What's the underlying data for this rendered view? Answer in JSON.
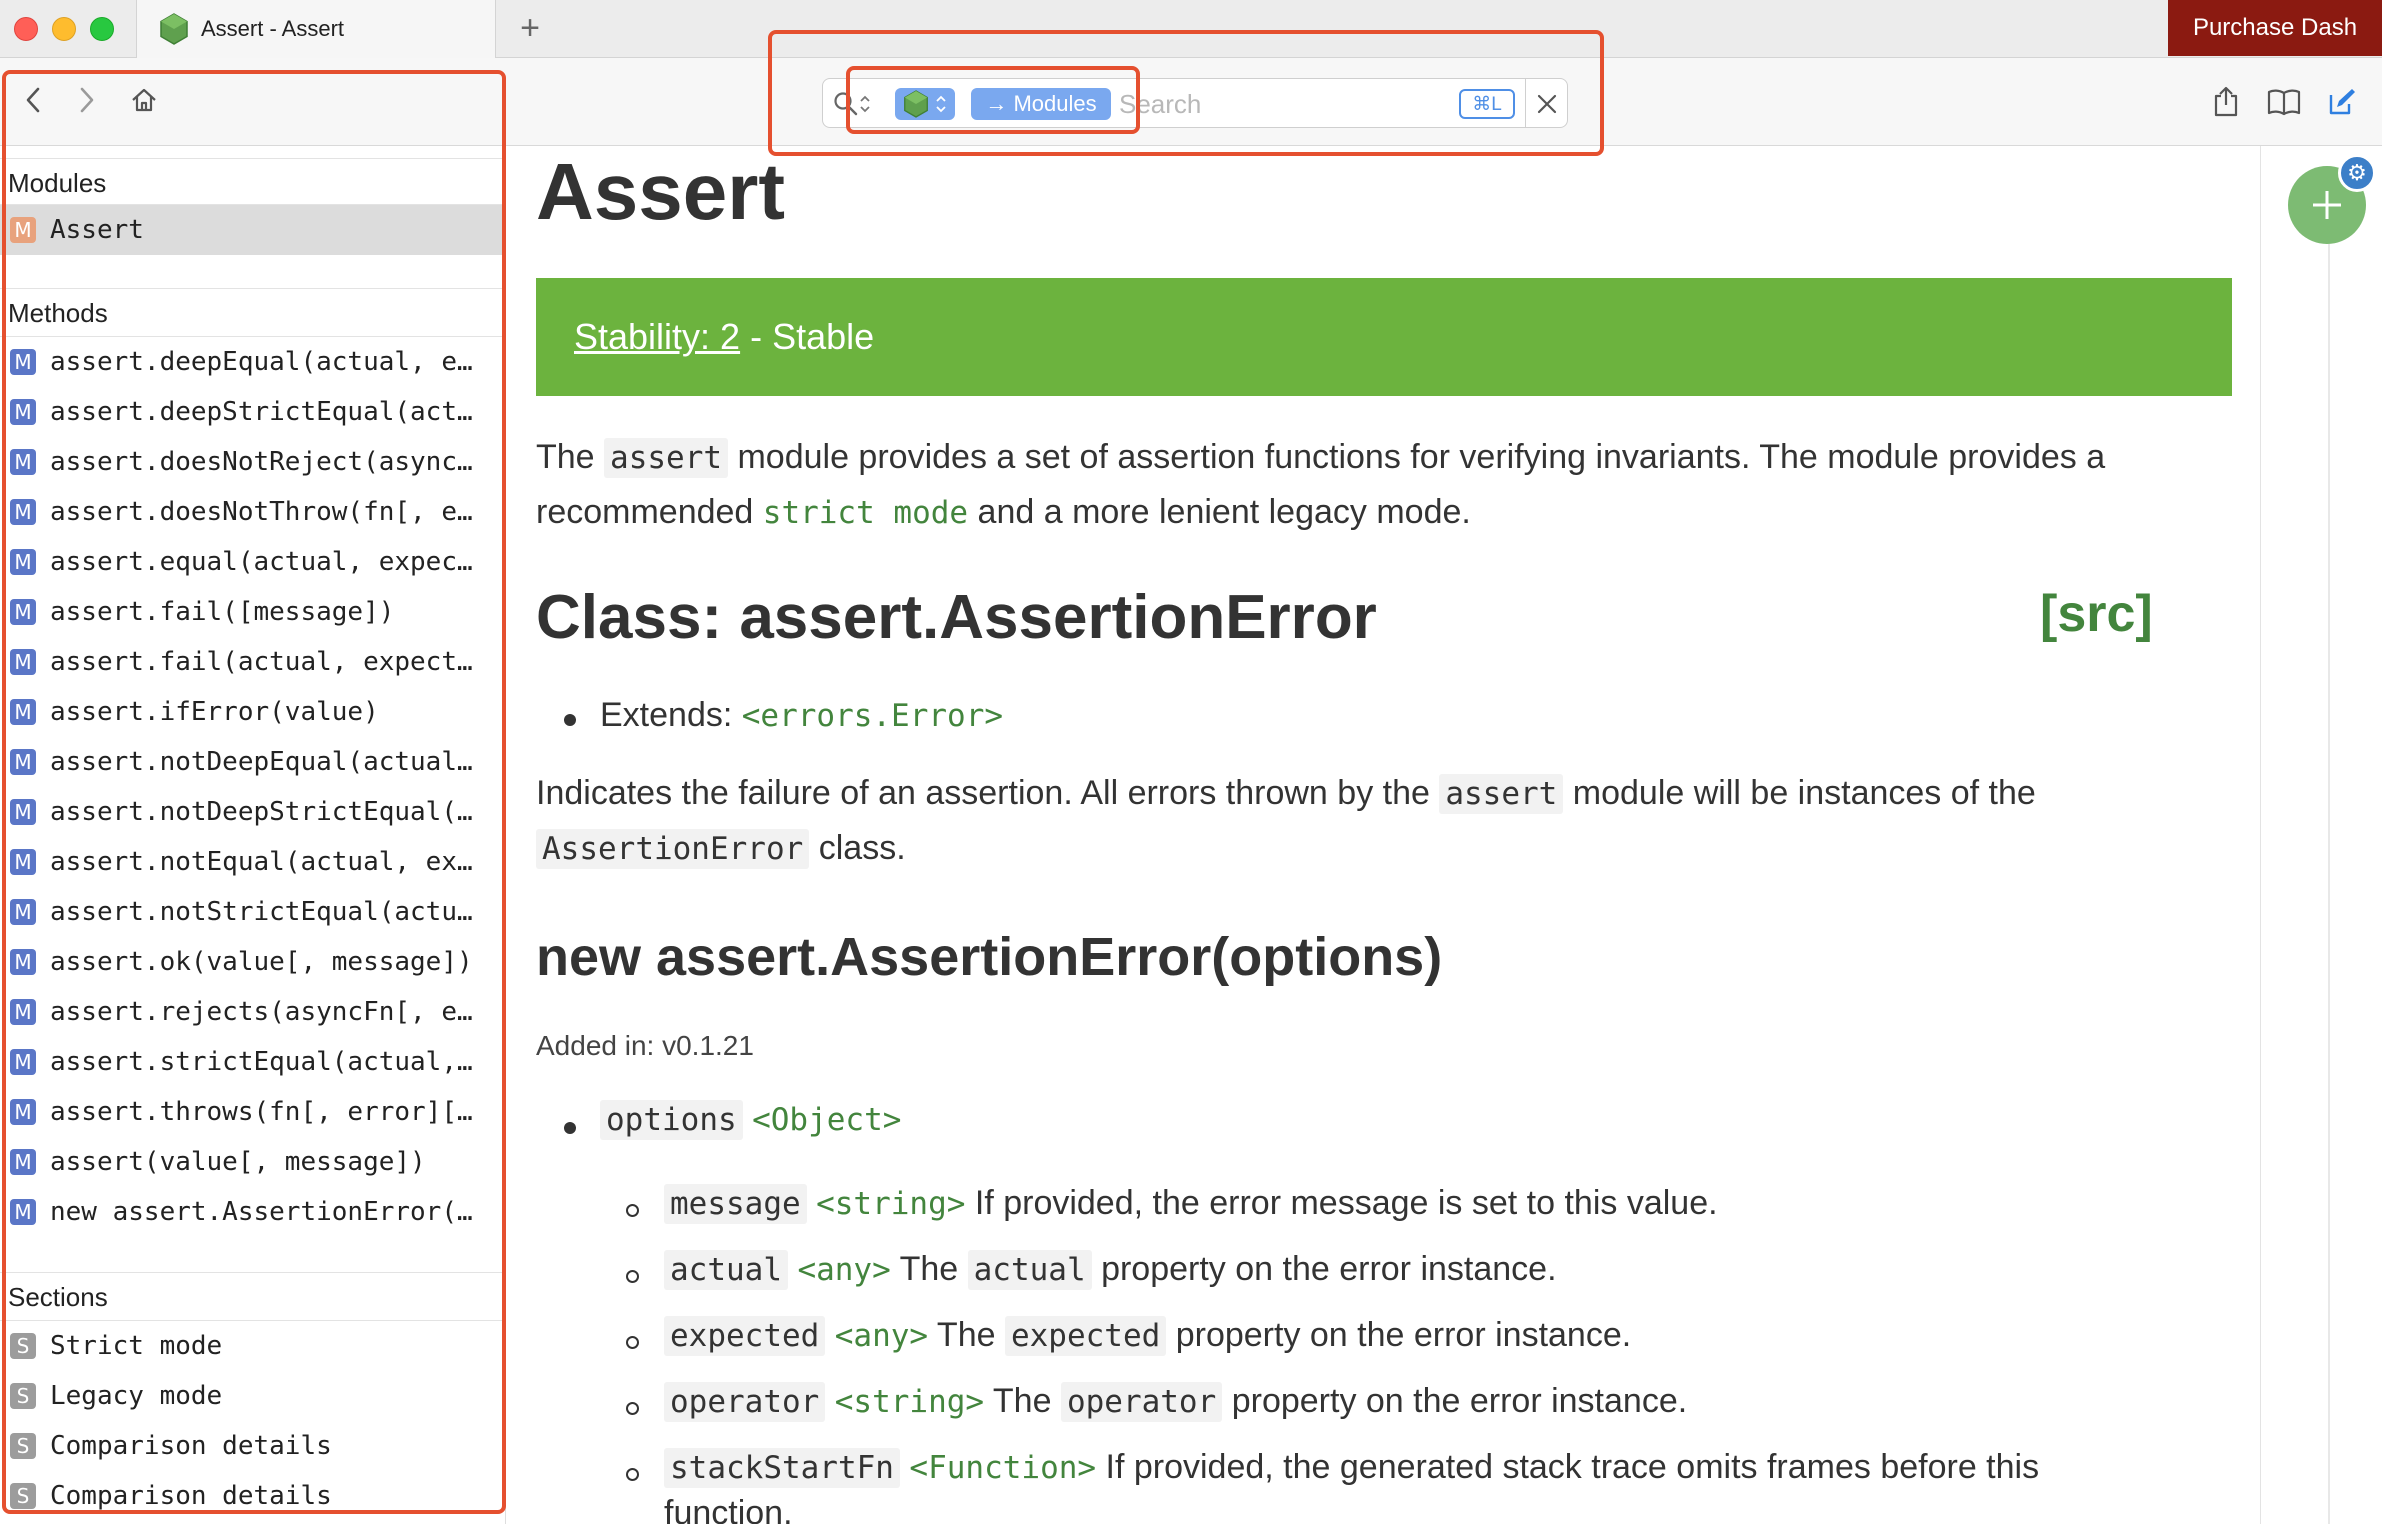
{
  "window": {
    "tab_title": "Assert - Assert",
    "new_tab_glyph": "+",
    "purchase_label": "Purchase Dash"
  },
  "toolbar": {
    "search": {
      "docset_icon": "nodejs-hexagon-icon",
      "scope_label": "→ Modules",
      "placeholder": "Search",
      "value": "",
      "shortcut_label": "⌘L"
    },
    "icons": [
      "back-icon",
      "forward-icon",
      "home-icon",
      "share-icon",
      "bookmarks-icon",
      "annotate-icon"
    ]
  },
  "sidebar": {
    "modules_header": "Modules",
    "modules": [
      {
        "badge": "M",
        "label": "Assert",
        "selected": true
      }
    ],
    "methods_header": "Methods",
    "methods": [
      {
        "badge": "M",
        "label": "assert.deepEqual(actual, e…"
      },
      {
        "badge": "M",
        "label": "assert.deepStrictEqual(act…"
      },
      {
        "badge": "M",
        "label": "assert.doesNotReject(async…"
      },
      {
        "badge": "M",
        "label": "assert.doesNotThrow(fn[, e…"
      },
      {
        "badge": "M",
        "label": "assert.equal(actual, expec…"
      },
      {
        "badge": "M",
        "label": "assert.fail([message])"
      },
      {
        "badge": "M",
        "label": "assert.fail(actual, expect…"
      },
      {
        "badge": "M",
        "label": "assert.ifError(value)"
      },
      {
        "badge": "M",
        "label": "assert.notDeepEqual(actual…"
      },
      {
        "badge": "M",
        "label": "assert.notDeepStrictEqual(…"
      },
      {
        "badge": "M",
        "label": "assert.notEqual(actual, ex…"
      },
      {
        "badge": "M",
        "label": "assert.notStrictEqual(actu…"
      },
      {
        "badge": "M",
        "label": "assert.ok(value[, message])"
      },
      {
        "badge": "M",
        "label": "assert.rejects(asyncFn[, e…"
      },
      {
        "badge": "M",
        "label": "assert.strictEqual(actual,…"
      },
      {
        "badge": "M",
        "label": "assert.throws(fn[, error][…"
      },
      {
        "badge": "M",
        "label": "assert(value[, message])"
      },
      {
        "badge": "M",
        "label": "new assert.AssertionError(…"
      }
    ],
    "sections_header": "Sections",
    "sections": [
      {
        "badge": "S",
        "label": "Strict mode"
      },
      {
        "badge": "S",
        "label": "Legacy mode"
      },
      {
        "badge": "S",
        "label": "Comparison details"
      },
      {
        "badge": "S",
        "label": "Comparison details"
      }
    ]
  },
  "doc": {
    "title": "Assert",
    "stability_link": "Stability: 2",
    "stability_text": " - Stable",
    "intro": {
      "p1": "The ",
      "c1": "assert",
      "p2": " module provides a set of assertion functions for verifying invariants. The module provides a recommended ",
      "c2": "strict mode",
      "p3": " and a more lenient legacy mode."
    },
    "class_heading": "Class: assert.AssertionError",
    "src_label": "[src]",
    "extends_label": "Extends: ",
    "extends_type": "<errors.Error>",
    "indicates": {
      "p1": "Indicates the failure of an assertion. All errors thrown by the ",
      "c1": "assert",
      "p2": " module will be instances of the ",
      "c2": "AssertionError",
      "p3": " class."
    },
    "ctor_heading": "new assert.AssertionError(options)",
    "added_in": "Added in: v0.1.21",
    "options": {
      "name": "options",
      "type": "<Object>"
    },
    "params": [
      {
        "name": "message",
        "type": "<string>",
        "pre": " If provided, the error message is set to this value.",
        "code": "",
        "post": ""
      },
      {
        "name": "actual",
        "type": "<any>",
        "pre": " The ",
        "code": "actual",
        "post": " property on the error instance."
      },
      {
        "name": "expected",
        "type": "<any>",
        "pre": " The ",
        "code": "expected",
        "post": " property on the error instance."
      },
      {
        "name": "operator",
        "type": "<string>",
        "pre": " The ",
        "code": "operator",
        "post": " property on the error instance."
      },
      {
        "name": "stackStartFn",
        "type": "<Function>",
        "pre": " If provided, the generated stack trace omits frames before this",
        "code": "",
        "post": ""
      }
    ],
    "cutoff_text": "function."
  }
}
